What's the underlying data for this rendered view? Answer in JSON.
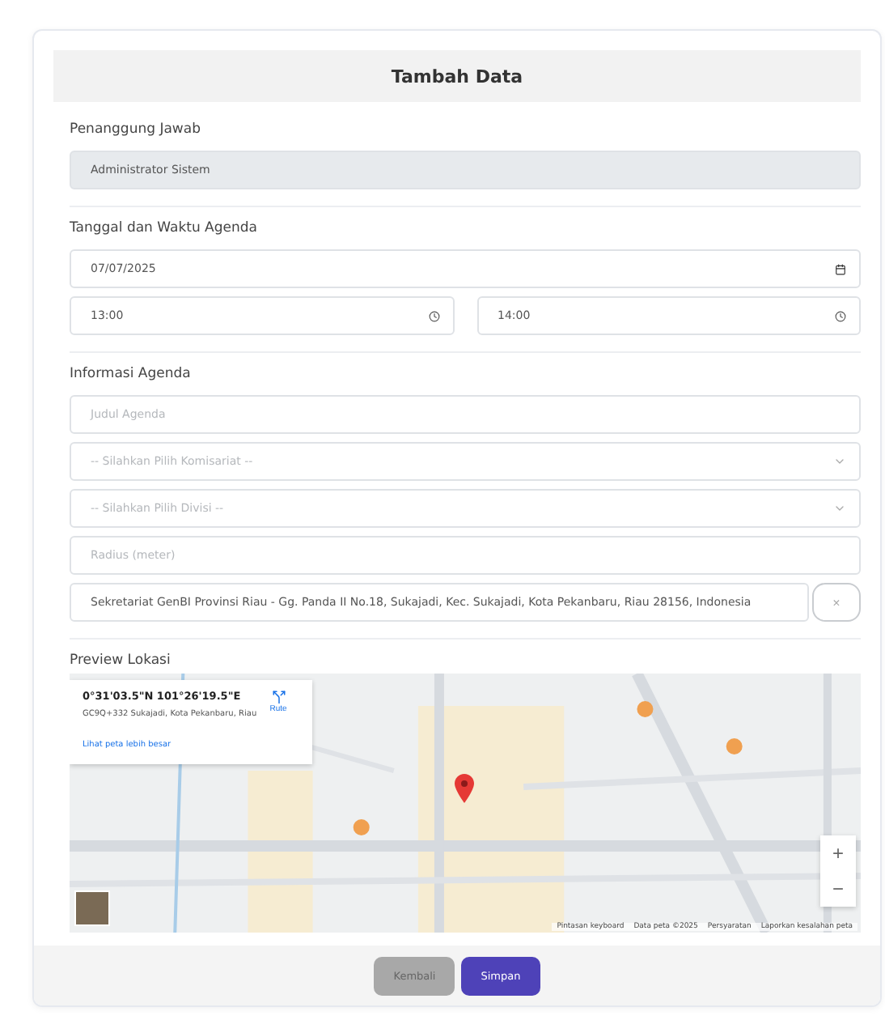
{
  "header": {
    "title": "Tambah Data"
  },
  "sections": [
    {
      "label": "Penanggung Jawab",
      "rows": [
        [
          {
            "kind": "readonly",
            "value": "Administrator Sistem"
          }
        ]
      ]
    },
    {
      "label": "Tanggal dan Waktu Agenda",
      "rows": [
        [
          {
            "kind": "date",
            "value": "07/07/2025"
          }
        ],
        [
          {
            "kind": "time",
            "value": "13:00"
          },
          {
            "kind": "time",
            "value": "14:00"
          }
        ]
      ]
    },
    {
      "label": "Informasi Agenda",
      "rows": [
        [
          {
            "kind": "text",
            "placeholder": "Judul Agenda"
          }
        ],
        [
          {
            "kind": "select",
            "placeholder": "-- Silahkan Pilih Komisariat --"
          }
        ],
        [
          {
            "kind": "select",
            "placeholder": "-- Silahkan Pilih Divisi --"
          }
        ],
        [
          {
            "kind": "text",
            "placeholder": "Radius (meter)"
          }
        ],
        [
          {
            "kind": "address",
            "value": "Sekretariat GenBI Provinsi Riau - Gg. Panda II No.18, Sukajadi, Kec. Sukajadi, Kota Pekanbaru, Riau 28156, Indonesia",
            "button": "×"
          }
        ]
      ]
    }
  ],
  "map": {
    "label": "Preview Lokasi",
    "info_card": {
      "coordinates": "0°31'03.5\"N 101°26'19.5\"E",
      "address": "GC9Q+332 Sukajadi, Kota Pekanbaru, Riau",
      "route": "Rute",
      "link": "Lihat peta lebih besar"
    },
    "zoom": [
      "+",
      "−"
    ],
    "attribution": [
      "Pintasan keyboard",
      "Data peta ©2025",
      "Persyaratan",
      "Laporkan kesalahan peta"
    ]
  },
  "buttons": [
    {
      "label": "Kembali",
      "kind": "secondary"
    },
    {
      "label": "Simpan",
      "kind": "primary"
    }
  ]
}
